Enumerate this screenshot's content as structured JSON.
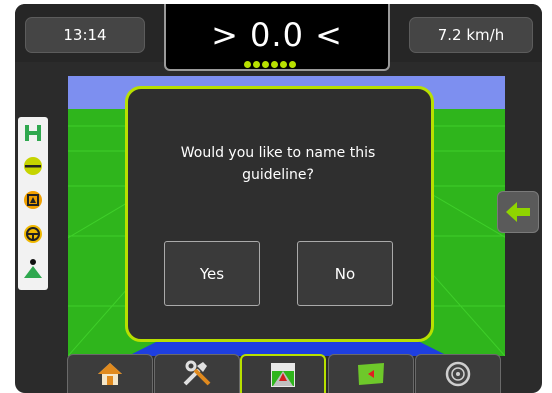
{
  "status_bar": {
    "time": "13:14",
    "guidance_value": "> 0.0 <",
    "speed": "7.2 km/h"
  },
  "dialog": {
    "message": "Would you like to name this guideline?",
    "yes_label": "Yes",
    "no_label": "No"
  },
  "colors": {
    "accent": "#b8e000",
    "sky": "#7d8ff0",
    "ground": "#2fb51c"
  },
  "side_toolbar": {
    "items": [
      "guideline-mode-icon",
      "marked-point-icon",
      "boundary-icon",
      "steering-wheel-icon",
      "vehicle-icon"
    ]
  },
  "nav_tabs": {
    "items": [
      "home-icon",
      "tools-icon",
      "guidance-view-icon",
      "field-map-icon",
      "dashboard-gauge-icon"
    ],
    "active": "guidance-view-icon"
  }
}
